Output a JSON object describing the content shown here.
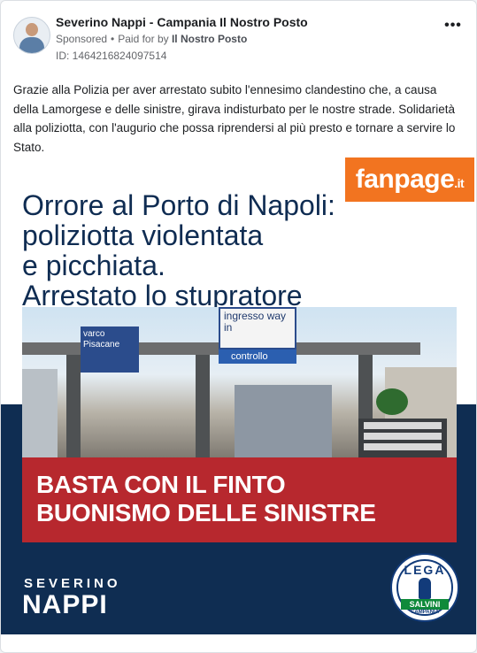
{
  "post": {
    "page_name": "Severino Nappi - Campania Il Nostro Posto",
    "sponsored_label": "Sponsored",
    "separator": "•",
    "paid_for_prefix": "Paid for by",
    "paid_for_name": "Il Nostro Posto",
    "ad_id": "ID: 1464216824097514",
    "more_icon": "more-options-icon",
    "body_text": "Grazie alla Polizia per aver arrestato subito l'ennesimo clandestino che, a causa della Lamorgese e delle sinistre, girava indisturbato per le nostre strade. Solidarietà alla poliziotta, con l'augurio che possa riprendersi al più presto e tornare a servire lo Stato."
  },
  "creative": {
    "fanpage_logo": "fanpage",
    "fanpage_suffix": ".it",
    "headline_lines": [
      "Orrore al Porto di Napoli:",
      "poliziotta violentata",
      "e picchiata.",
      "Arrestato lo stupratore"
    ],
    "photo_sign_left": "varco Pisacane",
    "photo_sign_center": "ingresso way in",
    "photo_sign_center_sub": "controllo",
    "banner_lines": [
      "BASTA CON IL FINTO",
      "BUONISMO DELLE SINISTRE"
    ],
    "signature_first": "SEVERINO",
    "signature_last": "NAPPI",
    "lega_logo": {
      "word": "LEGA",
      "name": "SALVINI",
      "region": "CAMPANIA"
    }
  },
  "colors": {
    "fanpage_orange": "#f27420",
    "headline_navy": "#0f2c52",
    "band_navy": "#0f2d52",
    "banner_red": "#b7282e",
    "lega_blue": "#123b7a",
    "lega_green": "#0f8a3a"
  }
}
